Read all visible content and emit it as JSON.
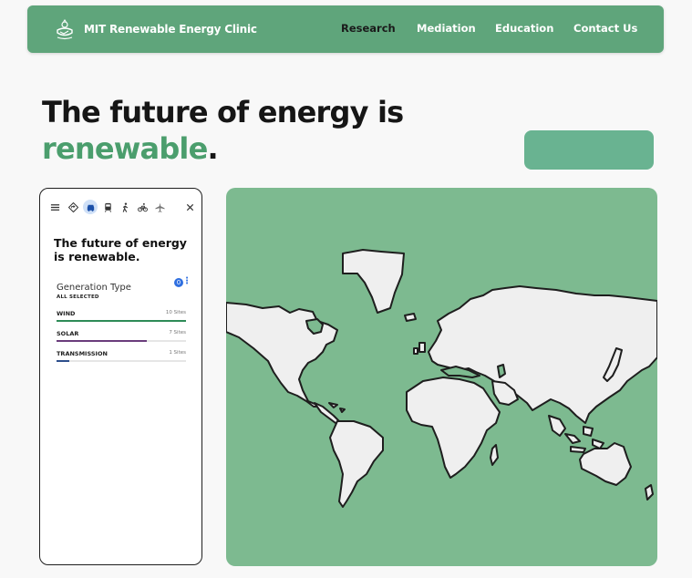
{
  "nav": {
    "brand": "MIT Renewable Energy Clinic",
    "links": [
      {
        "label": "Research"
      },
      {
        "label": "Mediation"
      },
      {
        "label": "Education"
      },
      {
        "label": "Contact Us"
      }
    ]
  },
  "hero": {
    "title_line1": "The future of energy is",
    "title_accent": "renewable",
    "title_period": "."
  },
  "panel": {
    "toolbar_icons": [
      "menu-icon",
      "directions-icon",
      "car-icon",
      "transit-icon",
      "walk-icon",
      "bike-icon",
      "flight-icon",
      "close-icon"
    ],
    "title": "The future of energy is renewable.",
    "section_label": "Generation Type",
    "badge_count": "0",
    "kebab": "⋮",
    "filter_label": "ALL SELECTED",
    "generation": [
      {
        "name": "WIND",
        "sites": "10 Sites",
        "fill": 1.0,
        "color": "#2e8b57"
      },
      {
        "name": "SOLAR",
        "sites": "7 Sites",
        "fill": 0.7,
        "color": "#6a3d7c"
      },
      {
        "name": "TRANSMISSION",
        "sites": "1 Sites",
        "fill": 0.1,
        "color": "#2d4f8c"
      }
    ]
  },
  "colors": {
    "brand_green": "#5fa57b",
    "accent_text": "#4b9e6d",
    "map_water": "#7dba90",
    "map_land": "#efefef",
    "button": "#69b391"
  }
}
